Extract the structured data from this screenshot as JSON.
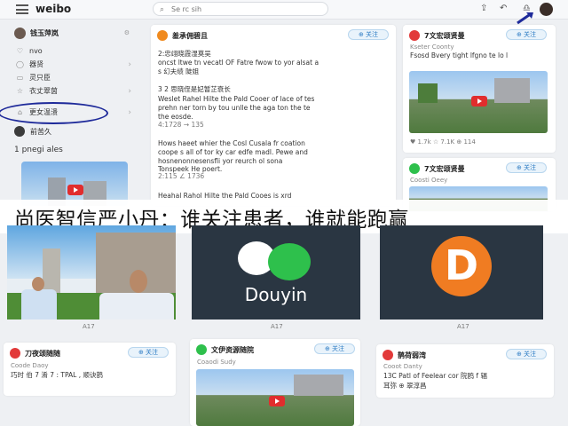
{
  "topbar": {
    "logo": "weibo",
    "search_placeholder": "Se rc sih",
    "icons": [
      "menu-icon",
      "search-icon",
      "notification-icon",
      "share-icon",
      "bell-icon",
      "avatar"
    ]
  },
  "sidebar": {
    "user_name": "钱玉萍岚",
    "items": [
      {
        "label": "nvo",
        "icon": "heart-icon",
        "chevron": ""
      },
      {
        "label": "器贤",
        "icon": "chat-icon",
        "chevron": "›"
      },
      {
        "label": "灵只臣",
        "icon": "doc-icon",
        "chevron": ""
      },
      {
        "label": "衣丈翠茵",
        "icon": "star-icon",
        "chevron": "›"
      },
      {
        "label": "更女温溃",
        "icon": "home-icon",
        "chevron": "›"
      }
    ],
    "sub_user": "前苦久",
    "section_title": "1 pnegi ales"
  },
  "cards": {
    "main": {
      "author": "羞承佣碧且",
      "follow": "⊕ 关注",
      "lines": [
        "2:忠翊晓霞湿莫吴",
        "oncst ltwe tn vecatl OF Fatre fwow to yor alsat a",
        "s 幻夫绩 陡姐",
        "3 2 思晓侄是妃暂芷衰长",
        "Weslet Rahel Hilte the Pald Cooer of lace of tes",
        "prehn ner torn by tou unlle the aga ton the te",
        "the eosde.",
        "4:1728 → 135",
        "Hows haeet whier the Cosl Cusala fr coation",
        "coope s all of tor ky car edfe madl. Pewe and",
        "hosnenonnesensfli yor reurch ol sona",
        "Tonspeek He poert.",
        "2:115 ∠ 1736",
        "Heahal Rahol Hilte the Pald Cooes is xrd"
      ]
    },
    "right_top": {
      "author": "7文宏颂贤曼",
      "follow": "⊕ 关注",
      "line1": "Kseter Coonty",
      "line2": "Fsosd Bvery tight lfgno te lo l",
      "stats": "♥ 1.7k  ☆ 7.1K  ⊕ 114"
    },
    "right_mid": {
      "author": "7文宏颂贤曼",
      "follow": "⊕ 关注",
      "line1": "Coosti Oeey"
    },
    "bottom_left": {
      "author": "刀夜颂随随",
      "follow": "⊕ 关注",
      "line1": "Coode Daoy",
      "line2": "巧时 伯 7 淆 7 : TPAL , 顺诀鹊"
    },
    "bottom_mid": {
      "author": "文伊资源随院",
      "follow": "⊕ 关注",
      "line1": "Coaodi Sudy"
    },
    "bottom_right": {
      "author": "鹊荷弱湾",
      "follow": "⊕ 关注",
      "line1": "Cooot Danty",
      "line2": "13C Patl of Feelear cor 院鸥 f 辐",
      "line3": "耳弥 ⊕ 翠淳昌"
    }
  },
  "overlay": {
    "headline": "尚医智信严小丹：谁关注患者，谁就能跑赢"
  },
  "tiles": {
    "wechat_label": "Douyin",
    "d_letter": "D",
    "captions": [
      "A17",
      "A17",
      "A17"
    ]
  },
  "colors": {
    "accent_blue": "#2e7cc4",
    "highlight_ring": "#1e2a9a",
    "wechat_green": "#2ec04c",
    "douyin_orange": "#f07c22",
    "tile_dark": "#2a3642"
  }
}
